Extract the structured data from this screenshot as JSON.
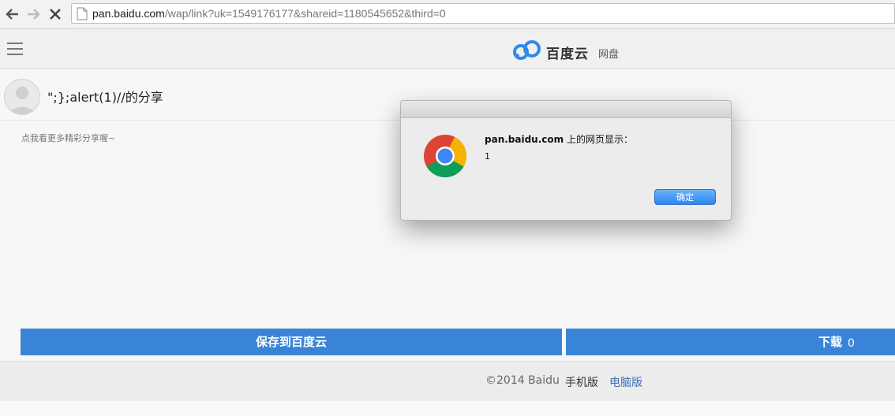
{
  "browser": {
    "url_host": "pan.baidu.com",
    "url_path": "/wap/link?uk=1549176177&shareid=1180545652&third=0",
    "icons": [
      "back-icon",
      "forward-icon",
      "stop-icon",
      "page-icon"
    ]
  },
  "header": {
    "logo_text": "百度云",
    "logo_sub": "网盘"
  },
  "share": {
    "title": "\";};alert(1)//的分享",
    "more_link": "点我看更多精彩分享喔~"
  },
  "actions": {
    "save_label": "保存到百度云",
    "download_label": "下载",
    "download_count": "0"
  },
  "footer": {
    "copyright": "©2014 Baidu",
    "mobile": "手机版",
    "desktop": "电脑版"
  },
  "dialog": {
    "host": "pan.baidu.com",
    "heading_suffix": " 上的网页显示：",
    "message": "1",
    "ok_label": "确定"
  },
  "colors": {
    "accent": "#3a84d7",
    "link": "#3a6fb7"
  }
}
